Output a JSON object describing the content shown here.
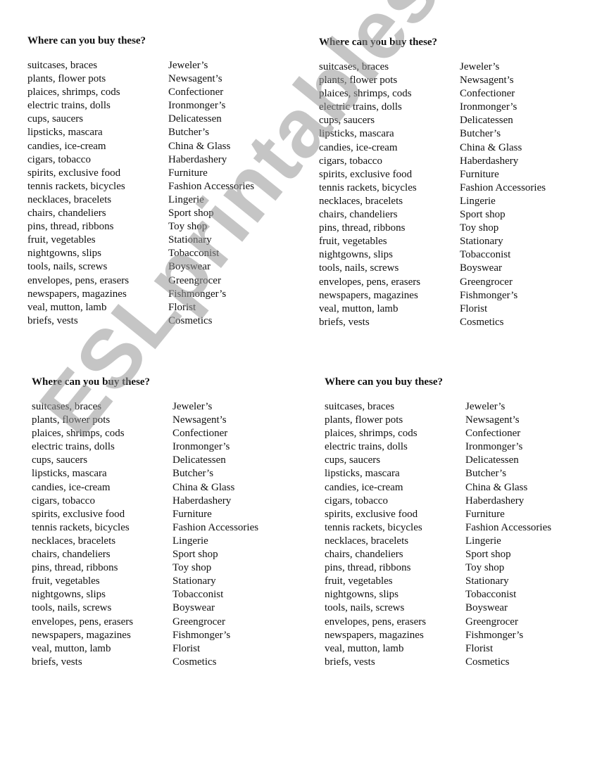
{
  "worksheet": {
    "title": "Where can you buy these?",
    "items": [
      "suitcases, braces",
      "plants, flower pots",
      "plaices, shrimps, cods",
      "electric trains, dolls",
      "cups, saucers",
      "lipsticks, mascara",
      "candies, ice-cream",
      "cigars, tobacco",
      "spirits, exclusive food",
      "tennis rackets, bicycles",
      "necklaces, bracelets",
      "chairs, chandeliers",
      "pins, thread, ribbons",
      "fruit, vegetables",
      "nightgowns, slips",
      "tools, nails, screws",
      "envelopes, pens, erasers",
      "newspapers, magazines",
      "veal, mutton, lamb",
      "briefs, vests"
    ],
    "shops": [
      "Jeweler’s",
      "Newsagent’s",
      "Confectioner",
      "Ironmonger’s",
      "Delicatessen",
      "Butcher’s",
      "China & Glass",
      "Haberdashery",
      "Furniture",
      "Fashion Accessories",
      "Lingerie",
      "Sport shop",
      "Toy shop",
      "Stationary",
      "Tobacconist",
      "Boyswear",
      "Greengrocer",
      "Fishmonger’s",
      "Florist",
      "Cosmetics"
    ]
  },
  "watermark": "ESLprintables.com"
}
